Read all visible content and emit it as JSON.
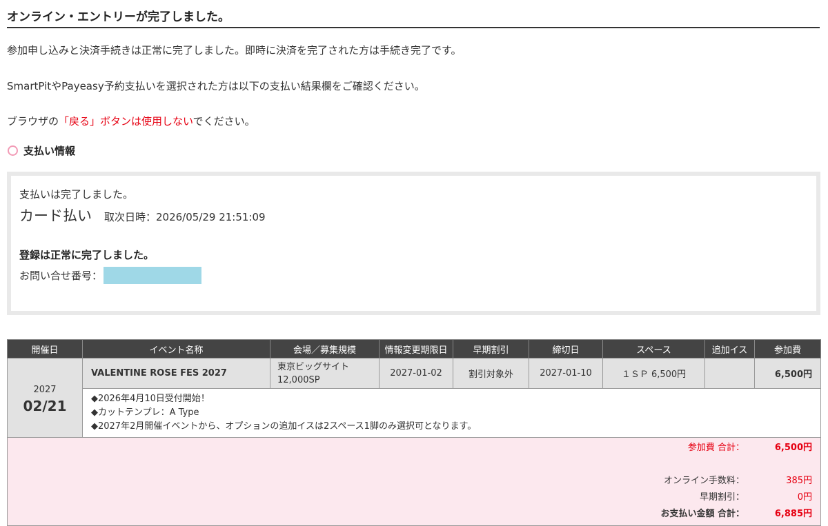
{
  "page_title": "オンライン・エントリーが完了しました。",
  "messages": {
    "line1": "参加申し込みと決済手続きは正常に完了しました。即時に決済を完了された方は手続き完了です。",
    "line2": "SmartPitやPayeasy予約支払いを選択された方は以下の支払い結果欄をご確認ください。",
    "line3_pre": "ブラウザの",
    "line3_red": "「戻る」ボタンは使用しない",
    "line3_post": "でください。"
  },
  "section": {
    "title": "支払い情報"
  },
  "payment": {
    "status": "支払いは完了しました。",
    "method": "カード払い",
    "datetime_label": "取次日時：2026/05/29 21:51:09",
    "registration": "登録は正常に完了しました。",
    "inquiry_label": "お問い合せ番号："
  },
  "table": {
    "headers": [
      "開催日",
      "イベント名称",
      "会場／募集規模",
      "情報変更期限日",
      "早期割引",
      "締切日",
      "スペース",
      "追加イス",
      "参加費"
    ],
    "row": {
      "year": "2027",
      "month_day": "02/21",
      "event_name": "VALENTINE ROSE FES 2027",
      "venue": "東京ビッグサイト",
      "scale": "12,000SP",
      "change_deadline": "2027-01-02",
      "early_discount": "割引対象外",
      "deadline": "2027-01-10",
      "space": "１ＳＰ 6,500円",
      "extra_chair": "",
      "fee": "6,500円"
    },
    "notes": [
      "◆2026年4月10日受付開始！",
      "◆カットテンプレ：A Type",
      "◆2027年2月開催イベントから、オプションの追加イスは2スペース1脚のみ選択可となります。"
    ]
  },
  "summary": {
    "fee_total_label": "参加費 合計：",
    "fee_total": "6,500円",
    "online_fee_label": "オンライン手数料：",
    "online_fee": "385円",
    "early_discount_label": "早期割引：",
    "early_discount": "0円",
    "grand_total_label": "お支払い金額 合計：",
    "grand_total": "6,885円"
  },
  "colors": {
    "accent_red": "#e60012",
    "ring_pink": "#f29bb6",
    "summary_bg": "#fce8ee",
    "mask": "#9fd8e7"
  }
}
